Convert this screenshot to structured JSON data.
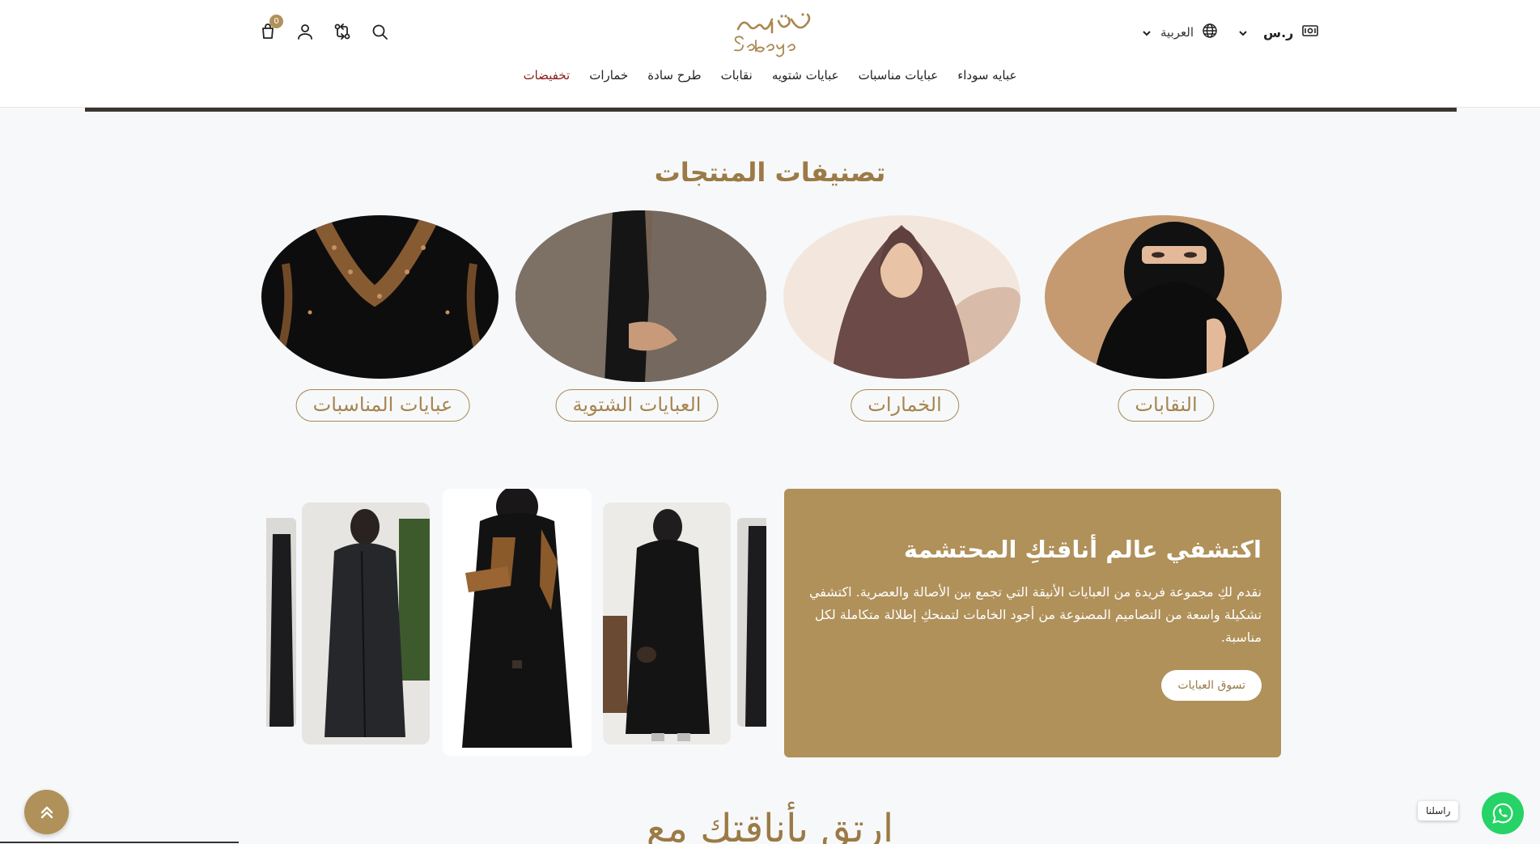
{
  "header": {
    "cart_count": "0",
    "language": "العربية",
    "currency_symbol": "ر.س",
    "nav": [
      {
        "label": "عبايه سوداء"
      },
      {
        "label": "عبايات مناسبات"
      },
      {
        "label": "عبايات شتويه"
      },
      {
        "label": "نقابات"
      },
      {
        "label": "طرح سادة"
      },
      {
        "label": "خمارات"
      },
      {
        "label": "تخفيضات"
      }
    ],
    "icons": [
      "cart-icon",
      "user-icon",
      "compare-icon",
      "search-icon",
      "globe-icon",
      "currency-icon",
      "chevron-down-icon"
    ]
  },
  "categories": {
    "title": "تصنيفات المنتجات",
    "items": [
      {
        "label": "النقابات"
      },
      {
        "label": "الخمارات"
      },
      {
        "label": "العبايات الشتوية"
      },
      {
        "label": "عبايات المناسبات"
      }
    ]
  },
  "promo": {
    "heading": "اكتشفي عالم أناقتكِ المحتشمة",
    "body": "نقدم لكِ مجموعة فريدة من العبايات الأنيقة التي تجمع بين الأصالة والعصرية. اكتشفي تشكيلة واسعة من التصاميم المصنوعة من أجود الخامات لتمنحكِ إطلالة متكاملة لكل مناسبة.",
    "button": "تسوق العبايات"
  },
  "tagline": "ارتقِ بأناقتك مع",
  "whatsapp": {
    "tooltip": "راسلنا"
  },
  "colors": {
    "brand": "#b0915a",
    "title": "#9b7a45",
    "sale": "#8a1c1c",
    "whatsapp": "#25d366"
  }
}
